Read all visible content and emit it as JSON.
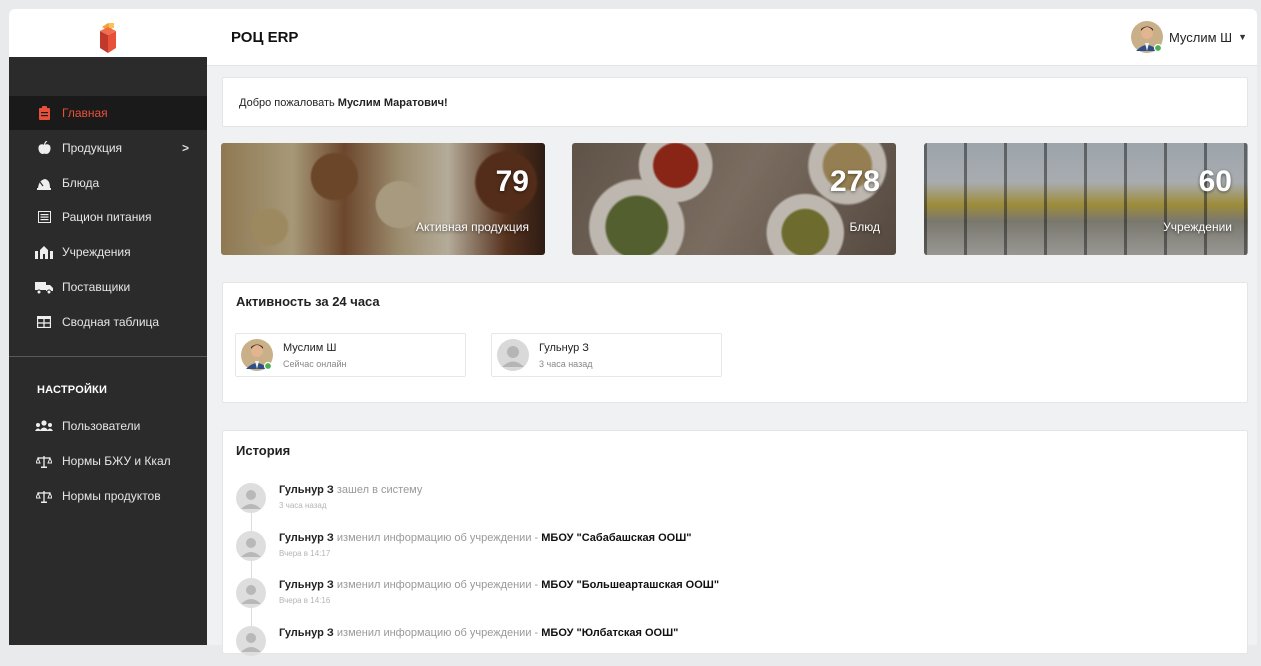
{
  "app": {
    "title": "РОЦ ERP"
  },
  "user": {
    "name": "Муслим Ш"
  },
  "sidebar": {
    "items": [
      {
        "label": "Главная",
        "icon": "clipboard-icon",
        "active": true
      },
      {
        "label": "Продукция",
        "icon": "apple-icon",
        "has_submenu": true
      },
      {
        "label": "Блюда",
        "icon": "cloche-icon"
      },
      {
        "label": "Рацион питания",
        "icon": "list-icon"
      },
      {
        "label": "Учреждения",
        "icon": "building-icon"
      },
      {
        "label": "Поставщики",
        "icon": "truck-icon"
      },
      {
        "label": "Сводная таблица",
        "icon": "table-icon"
      }
    ],
    "settings_title": "НАСТРОЙКИ",
    "settings_items": [
      {
        "label": "Пользователи",
        "icon": "users-icon"
      },
      {
        "label": "Нормы БЖУ и Ккал",
        "icon": "balance-scale-icon"
      },
      {
        "label": "Нормы продуктов",
        "icon": "balance-scale-icon"
      }
    ],
    "submenu_arrow": ">"
  },
  "welcome": {
    "prefix": "Добро пожаловать",
    "name": "Муслим Маратович!"
  },
  "stats": [
    {
      "value": "79",
      "label": "Активная продукция"
    },
    {
      "value": "278",
      "label": "Блюд"
    },
    {
      "value": "60",
      "label": "Учреждении"
    }
  ],
  "activity": {
    "title": "Активность за 24 часа",
    "users": [
      {
        "name": "Муслим Ш",
        "status": "Сейчас онлайн",
        "online": true
      },
      {
        "name": "Гульнур З",
        "status": "3 часа назад",
        "online": false
      }
    ]
  },
  "history": {
    "title": "История",
    "items": [
      {
        "actor": "Гульнур З",
        "action": "зашел в систему",
        "target": "",
        "time": "3 часа назад"
      },
      {
        "actor": "Гульнур З",
        "action": "изменил информацию об учреждении -",
        "target": "МБОУ \"Сабабашская ООШ\"",
        "time": "Вчера в 14:17"
      },
      {
        "actor": "Гульнур З",
        "action": "изменил информацию об учреждении -",
        "target": "МБОУ \"Большеарташская ООШ\"",
        "time": "Вчера в 14:16"
      },
      {
        "actor": "Гульнур З",
        "action": "изменил информацию об учреждении -",
        "target": "МБОУ \"Юлбатская ООШ\"",
        "time": ""
      }
    ]
  },
  "colors": {
    "accent": "#e8503a",
    "sidebar_bg": "#2b2b2b",
    "online": "#4caf50"
  }
}
